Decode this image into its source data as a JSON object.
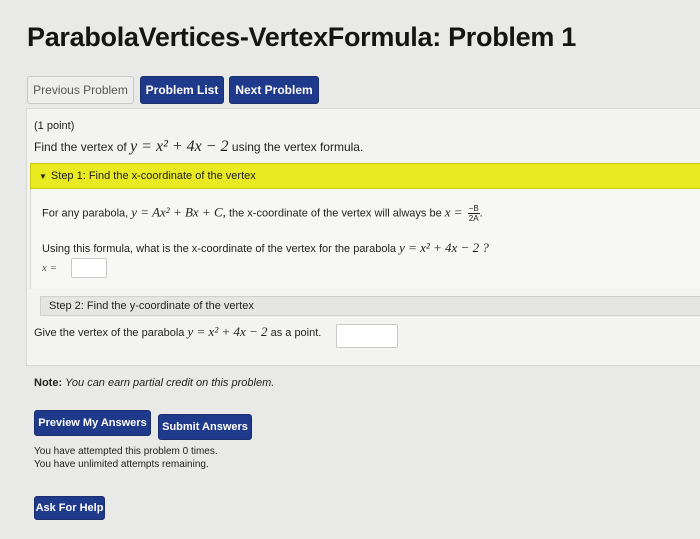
{
  "header": {
    "title": "ParabolaVertices-VertexFormula: Problem 1"
  },
  "nav": {
    "previous": "Previous Problem",
    "list": "Problem List",
    "next": "Next Problem"
  },
  "problem": {
    "points": "(1 point)",
    "prompt_pre": "Find the vertex of",
    "equation": "y = x² + 4x − 2",
    "prompt_post": "using the vertex formula."
  },
  "step1": {
    "header": "Step 1: Find the x-coordinate of the vertex",
    "line1_pre": "For any parabola,",
    "line1_eq": "y = Ax² + Bx + C,",
    "line1_mid": "the x-coordinate of the vertex will always be",
    "line1_x": "x =",
    "frac_num": "−B",
    "frac_den": "2A",
    "line2_pre": "Using this formula, what is the x-coordinate of the vertex for the parabola",
    "line2_eq": "y = x² + 4x − 2 ?",
    "input_label": "x =",
    "input_value": ""
  },
  "step2": {
    "header": "Step 2: Find the y-coordinate of the vertex",
    "prompt_pre": "Give the vertex of the parabola",
    "prompt_eq": "y = x² + 4x − 2",
    "prompt_post": "as a point.",
    "input_value": ""
  },
  "note": {
    "label": "Note:",
    "text": "You can earn partial credit on this problem."
  },
  "actions": {
    "preview": "Preview My Answers",
    "submit": "Submit Answers",
    "help": "Ask For Help"
  },
  "status": {
    "attempted": "You have attempted this problem 0 times.",
    "remaining": "You have unlimited attempts remaining."
  },
  "colors": {
    "primary": "#1f3a8a",
    "step_highlight": "#eaea22"
  },
  "icons": {
    "step_toggle": "caret-down-icon"
  }
}
